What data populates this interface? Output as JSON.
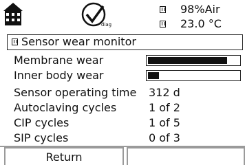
{
  "header": {
    "status_1": "98%Air",
    "status_2": "23.0 °C"
  },
  "title": "Sensor wear monitor",
  "rows": [
    {
      "label": "Membrane wear",
      "wear_level": 0.87
    },
    {
      "label": "Inner body wear",
      "wear_level": 0.12
    },
    {
      "label": "Sensor operating time",
      "value": "312 d"
    },
    {
      "label": "Autoclaving cycles",
      "value": "1 of 2"
    },
    {
      "label": "CIP cycles",
      "value": "1 of 5"
    },
    {
      "label": "SIP cycles",
      "value": "0 of 3"
    }
  ],
  "softkeys": {
    "left": "Return",
    "right": ""
  },
  "icons": {
    "house": "measuring-point-house-icon",
    "diag": "diag-check-icon",
    "card": "memory-card-icon"
  }
}
